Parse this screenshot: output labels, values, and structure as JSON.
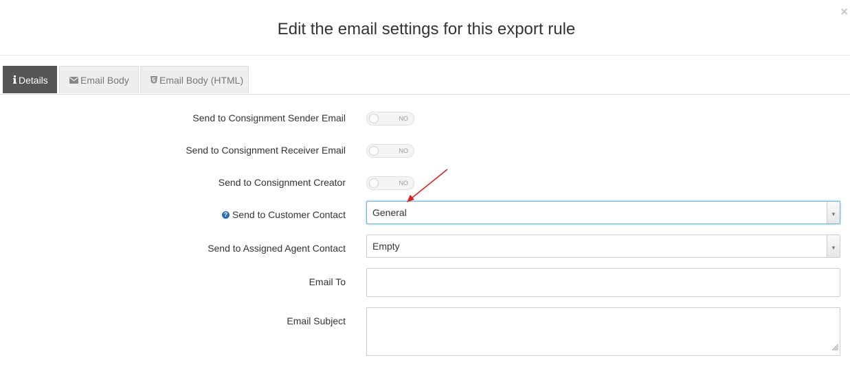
{
  "modal": {
    "title": "Edit the email settings for this export rule",
    "close_label": "×"
  },
  "tabs": [
    {
      "label": "Details",
      "icon": "info-icon",
      "active": true
    },
    {
      "label": "Email Body",
      "icon": "envelope-icon",
      "active": false
    },
    {
      "label": "Email Body (HTML)",
      "icon": "html5-icon",
      "active": false
    }
  ],
  "form": {
    "sender_email": {
      "label": "Send to Consignment Sender Email",
      "toggle_text": "NO",
      "value": false
    },
    "receiver_email": {
      "label": "Send to Consignment Receiver Email",
      "toggle_text": "NO",
      "value": false
    },
    "creator": {
      "label": "Send to Consignment Creator",
      "toggle_text": "NO",
      "value": false
    },
    "customer_contact": {
      "label": "Send to Customer Contact",
      "help_icon": "question-circle-icon",
      "selected": "General"
    },
    "agent_contact": {
      "label": "Send to Assigned Agent Contact",
      "selected": "Empty"
    },
    "email_to": {
      "label": "Email To",
      "value": ""
    },
    "email_subject": {
      "label": "Email Subject",
      "value": ""
    }
  },
  "colors": {
    "active_tab_bg": "#555555",
    "focus_border": "#66afe9",
    "help_icon": "#2a6db5",
    "annotation_arrow": "#e02020"
  }
}
